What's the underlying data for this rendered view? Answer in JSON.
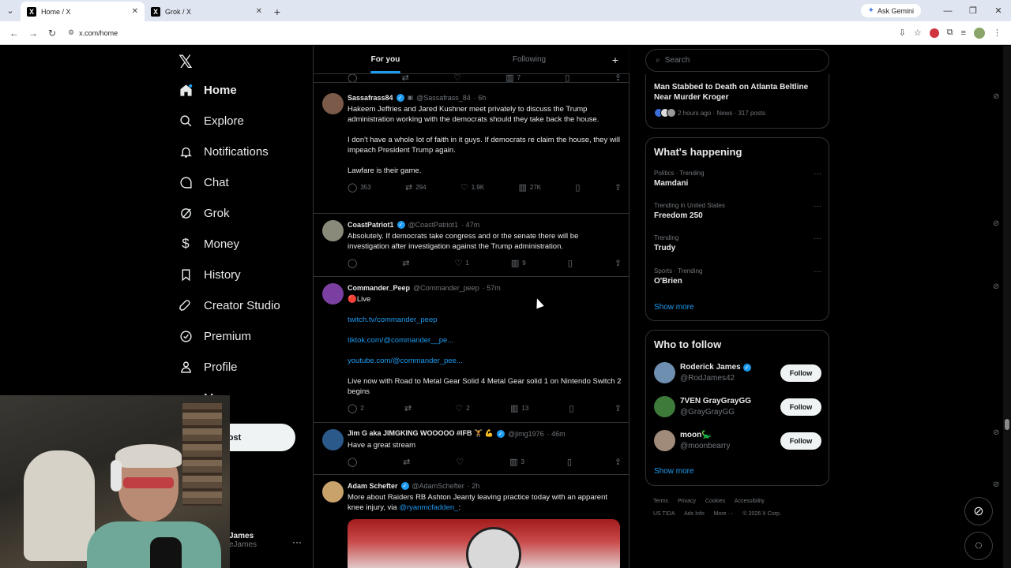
{
  "browser": {
    "tabs": [
      {
        "title": "Home / X",
        "active": true
      },
      {
        "title": "Grok / X",
        "active": false
      }
    ],
    "gemini_label": "Ask Gemini",
    "url": "x.com/home"
  },
  "nav": {
    "items": [
      {
        "label": "Home",
        "icon": "home-icon",
        "active": true
      },
      {
        "label": "Explore",
        "icon": "search-icon"
      },
      {
        "label": "Notifications",
        "icon": "bell-icon"
      },
      {
        "label": "Chat",
        "icon": "chat-icon"
      },
      {
        "label": "Grok",
        "icon": "grok-icon"
      },
      {
        "label": "Money",
        "icon": "money-icon"
      },
      {
        "label": "History",
        "icon": "bookmark-icon"
      },
      {
        "label": "Creator Studio",
        "icon": "rocket-icon"
      },
      {
        "label": "Premium",
        "icon": "verified-icon"
      },
      {
        "label": "Profile",
        "icon": "person-icon"
      },
      {
        "label": "M",
        "icon": "more-icon"
      }
    ],
    "post_label": "ost",
    "account_name": "James",
    "account_handle": "eJames"
  },
  "feed": {
    "tabs": [
      "For you",
      "Following"
    ],
    "top_actions": {
      "replies": "",
      "reposts": "",
      "likes": "",
      "views": "7"
    },
    "tweets": [
      {
        "name": "Sassafrass84",
        "handle": "@Sassafrass_84",
        "time": "· 6h",
        "text": "Hakeem Jeffries and Jared Kushner meet privately to discuss the Trump administration working with the democrats should they take back the house.\n\nI don't have a whole lot of faith in it guys. If democrats re claim the house, they will impeach President Trump again.\n\nLawfare is their game.",
        "replies": "353",
        "reposts": "294",
        "likes": "1.9K",
        "views": "27K",
        "avatar_color": "#7b5a4a"
      },
      {
        "name": "CoastPatriot1",
        "handle": "@CoastPatriot1",
        "time": "· 47m",
        "text": "Absolutely. If democrats take congress and or the senate there will be investigation after investigation against the Trump administration.",
        "replies": "",
        "reposts": "",
        "likes": "1",
        "views": "9",
        "avatar_color": "#8a8a7a"
      },
      {
        "name": "Commander_Peep",
        "handle": "@Commander_peep",
        "time": "· 57m",
        "text_prefix": "🔴Live",
        "links": [
          "twitch.tv/commander_peep",
          "tiktok.com/@commander__pe...",
          "youtube.com/@commander_pee..."
        ],
        "text_suffix": "Live now with Road to Metal Gear Solid 4 Metal Gear solid 1 on Nintendo Switch 2 begins",
        "replies": "2",
        "reposts": "",
        "likes": "2",
        "views": "13",
        "avatar_color": "#7a3fa0"
      },
      {
        "name": "Jim G aka JIMGKING WOOOOO #IFB 🏋 💪",
        "handle": "@jimg1976",
        "time": "· 46m",
        "text": "Have a great stream",
        "replies": "",
        "reposts": "",
        "likes": "",
        "views": "3",
        "avatar_color": "#2b5a8a"
      },
      {
        "name": "Adam Schefter",
        "handle": "@AdamSchefter",
        "time": "· 2h",
        "text": "More about Raiders RB Ashton Jeanty leaving practice today with an apparent knee injury, via ",
        "mention": "@ryanmcfadden_",
        "text_end": ":",
        "avatar_color": "#c9a26b"
      }
    ]
  },
  "right": {
    "search_placeholder": "Search",
    "news": {
      "title": "Man Stabbed to Death on Atlanta Beltline Near Murder Kroger",
      "meta": "2 hours ago · News · 317 posts"
    },
    "happening_title": "What's happening",
    "trends": [
      {
        "context": "Politics · Trending",
        "name": "Mamdani"
      },
      {
        "context": "Trending in United States",
        "name": "Freedom 250"
      },
      {
        "context": "Trending",
        "name": "Trudy"
      },
      {
        "context": "Sports · Trending",
        "name": "O'Brien"
      }
    ],
    "show_more": "Show more",
    "who_to_follow_title": "Who to follow",
    "follow": [
      {
        "name": "Roderick James",
        "handle": "@RodJames42",
        "verified": true,
        "avatar_color": "#6f8fb0"
      },
      {
        "name": "7VEN GrayGrayGG",
        "handle": "@GrayGrayGG",
        "verified": false,
        "avatar_color": "#3e7a3a"
      },
      {
        "name": "moon🦕",
        "handle": "@moonbearry",
        "verified": false,
        "avatar_color": "#a08a7a"
      }
    ],
    "follow_label": "Follow",
    "footer_line1": [
      "Terms",
      "Privacy",
      "Cookies",
      "Accessibility"
    ],
    "footer_line2": [
      "US TIDA",
      "Ads Info",
      "More ···",
      "© 2026 X Corp."
    ]
  }
}
